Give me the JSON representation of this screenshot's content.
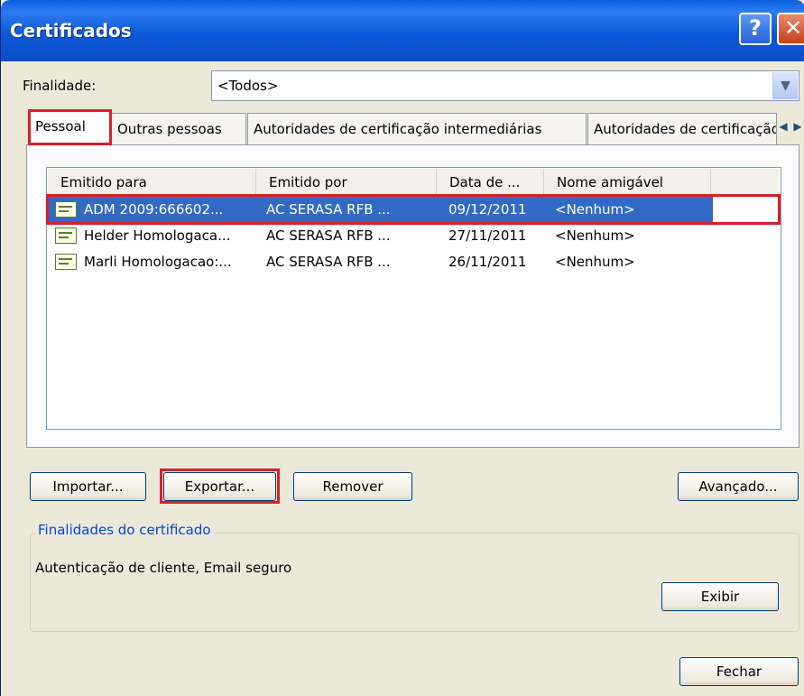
{
  "window": {
    "title": "Certificados",
    "help_glyph": "?",
    "close_glyph": "✕"
  },
  "finalidade": {
    "label": "Finalidade:",
    "value": "<Todos>",
    "arrow": "▼"
  },
  "tabs": [
    {
      "label": "Pessoal"
    },
    {
      "label": "Outras pessoas"
    },
    {
      "label": "Autoridades de certificação intermediárias"
    },
    {
      "label": "Autoridades de certificação raiz confiáveis"
    }
  ],
  "tab_scroll": {
    "left": "◀",
    "right": "▶"
  },
  "columns": [
    "Emitido para",
    "Emitido por",
    "Data de ...",
    "Nome amigável"
  ],
  "rows": [
    {
      "emitido_para": "ADM 2009:666602...",
      "emitido_por": "AC SERASA RFB ...",
      "data": "09/12/2011",
      "nome": "<Nenhum>",
      "selected": true
    },
    {
      "emitido_para": "Helder Homologaca...",
      "emitido_por": "AC SERASA RFB ...",
      "data": "27/11/2011",
      "nome": "<Nenhum>",
      "selected": false
    },
    {
      "emitido_para": "Marli Homologacao:...",
      "emitido_por": "AC SERASA RFB ...",
      "data": "26/11/2011",
      "nome": "<Nenhum>",
      "selected": false
    }
  ],
  "buttons": {
    "importar": "Importar...",
    "exportar": "Exportar...",
    "remover": "Remover",
    "avancado": "Avançado...",
    "exibir": "Exibir",
    "fechar": "Fechar"
  },
  "finalidades_group": {
    "legend": "Finalidades do certificado",
    "text": "Autenticação de cliente, Email seguro"
  },
  "colors": {
    "title_bar": "#0a5fe0",
    "selection": "#316ac5",
    "highlight_box": "#d8202a",
    "window_bg": "#ece9d8"
  }
}
